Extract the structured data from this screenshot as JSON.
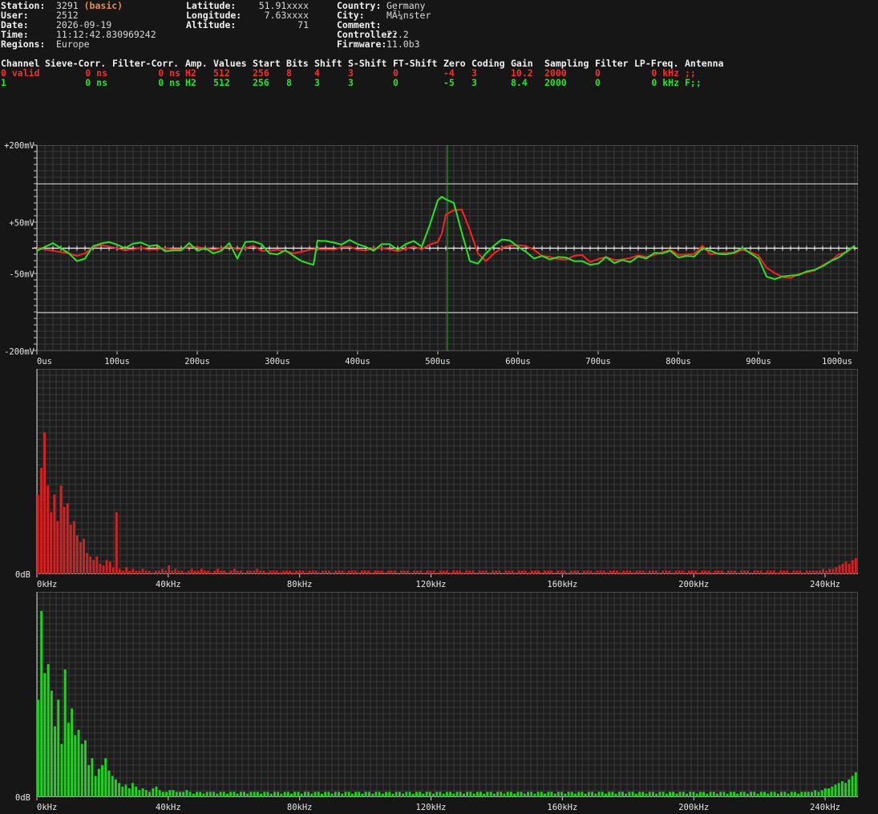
{
  "info_left": [
    {
      "label": "Station:",
      "value": "3291",
      "tag": "(basic)"
    },
    {
      "label": "User:",
      "value": "2512"
    },
    {
      "label": "Date:",
      "value": "2026-09-19"
    },
    {
      "label": "Time:",
      "value": "11:12:42.830969242"
    },
    {
      "label": "Regions:",
      "value": "Europe"
    }
  ],
  "info_mid": [
    {
      "label": "Latitude:",
      "value": "51.91xxxx"
    },
    {
      "label": "Longitude:",
      "value": "7.63xxxx"
    },
    {
      "label": "Altitude:",
      "value": "71"
    }
  ],
  "info_right": [
    {
      "label": "Country:",
      "value": "Germany"
    },
    {
      "label": "City:",
      "value": "MÃ¼nster"
    },
    {
      "label": "Comment:",
      "value": ""
    },
    {
      "label": "Controller:",
      "value": "22.2"
    },
    {
      "label": "Firmware:",
      "value": "11.0b3"
    }
  ],
  "channel_table": {
    "headers": [
      "Channel",
      "Sieve-Corr.",
      "Filter-Corr.",
      "Amp.",
      "Values",
      "Start",
      "Bits",
      "Shift",
      "S-Shift",
      "FT-Shift",
      "Zero",
      "Coding",
      "Gain",
      "Sampling",
      "Filter",
      "LP-Freq.",
      "Antenna"
    ],
    "rows": [
      {
        "color": "#ff2a2a",
        "cells": [
          "0 valid",
          "0 ns",
          "0 ns",
          "H2",
          "512",
          "256",
          "8",
          "4",
          "3",
          "0",
          "-4",
          "3",
          "10.2",
          "2000",
          "0",
          "0 kHz",
          ";;"
        ]
      },
      {
        "color": "#22e822",
        "cells": [
          "1",
          "0 ns",
          "0 ns",
          "H2",
          "512",
          "256",
          "8",
          "3",
          "3",
          "0",
          "-5",
          "3",
          "8.4",
          "2000",
          "0",
          "0 kHz",
          "F;;"
        ]
      }
    ]
  },
  "chart_data": [
    {
      "type": "line",
      "title": "",
      "xlabel": "",
      "ylabel": "",
      "xlim": [
        0,
        1024
      ],
      "ylim": [
        -200,
        200
      ],
      "x_tick_labels": [
        "0us",
        "100us",
        "200us",
        "300us",
        "400us",
        "500us",
        "600us",
        "700us",
        "800us",
        "900us",
        "1000us"
      ],
      "y_tick_labels": [
        {
          "label": "+200mV",
          "value": 200
        },
        {
          "label": "+50mV",
          "value": 50
        },
        {
          "label": "-50mV",
          "value": -50
        },
        {
          "label": "-200mV",
          "value": -200
        }
      ],
      "threshold_lines": [
        125,
        -125
      ],
      "trigger_marker_x": 512,
      "grid": true,
      "x": [
        0,
        20,
        40,
        50,
        60,
        70,
        80,
        90,
        100,
        110,
        120,
        130,
        140,
        150,
        160,
        170,
        180,
        190,
        200,
        210,
        220,
        230,
        240,
        250,
        260,
        270,
        280,
        290,
        300,
        310,
        320,
        330,
        340,
        345,
        350,
        355,
        360,
        370,
        380,
        390,
        400,
        410,
        420,
        430,
        440,
        450,
        460,
        470,
        480,
        490,
        500,
        505,
        510,
        520,
        530,
        540,
        550,
        560,
        570,
        580,
        590,
        600,
        610,
        620,
        630,
        640,
        650,
        660,
        670,
        680,
        690,
        700,
        710,
        720,
        730,
        740,
        750,
        760,
        770,
        780,
        790,
        800,
        810,
        820,
        830,
        840,
        850,
        860,
        870,
        880,
        890,
        900,
        910,
        920,
        930,
        940,
        950,
        960,
        970,
        980,
        990,
        1000,
        1010,
        1020
      ],
      "series": [
        {
          "color": "#ff2020",
          "values": [
            0,
            -5,
            -10,
            -15,
            -10,
            2,
            6,
            3,
            0,
            -4,
            -2,
            1,
            -3,
            -2,
            0,
            -2,
            -2,
            3,
            2,
            0,
            -3,
            0,
            3,
            -2,
            0,
            5,
            -5,
            -5,
            -3,
            -6,
            -10,
            -7,
            -3,
            -2,
            -1,
            -3,
            -2,
            -3,
            2,
            3,
            -3,
            -4,
            0,
            0,
            -2,
            -6,
            -1,
            3,
            -2,
            7,
            12,
            28,
            65,
            74,
            75,
            35,
            -10,
            -25,
            -10,
            1,
            5,
            6,
            4,
            -3,
            -15,
            -17,
            -21,
            -22,
            -15,
            -13,
            -27,
            -21,
            -17,
            -23,
            -22,
            -19,
            -14,
            -17,
            -13,
            -8,
            -3,
            -13,
            -12,
            -11,
            5,
            -12,
            -10,
            -9,
            -10,
            -3,
            -8,
            -14,
            -38,
            -48,
            -56,
            -58,
            -50,
            -47,
            -43,
            -33,
            -25,
            -12,
            -8,
            5
          ]
        },
        {
          "color": "#22e822",
          "values": [
            -5,
            10,
            -10,
            -25,
            -20,
            4,
            9,
            12,
            7,
            0,
            9,
            11,
            4,
            6,
            -6,
            -4,
            -4,
            10,
            -5,
            0,
            -10,
            -5,
            10,
            -20,
            12,
            13,
            8,
            -10,
            -12,
            -4,
            -15,
            -25,
            -30,
            -32,
            15,
            14,
            14,
            11,
            7,
            16,
            8,
            3,
            -5,
            8,
            8,
            -3,
            8,
            14,
            3,
            45,
            93,
            100,
            95,
            88,
            30,
            -25,
            -30,
            -10,
            5,
            17,
            15,
            3,
            -7,
            -20,
            -15,
            -22,
            -17,
            -18,
            -25,
            -25,
            -32,
            -30,
            -17,
            -29,
            -23,
            -27,
            -16,
            -20,
            -9,
            -10,
            -5,
            -18,
            -15,
            -16,
            0,
            -5,
            -11,
            -12,
            -8,
            1,
            -10,
            -20,
            -55,
            -60,
            -55,
            -53,
            -52,
            -45,
            -42,
            -35,
            -25,
            -18,
            -6,
            5
          ]
        }
      ]
    },
    {
      "type": "bar",
      "title": "",
      "xlabel": "",
      "ylabel": "",
      "xlim": [
        0,
        250
      ],
      "x_tick_labels": [
        "0kHz",
        "40kHz",
        "80kHz",
        "120kHz",
        "160kHz",
        "200kHz",
        "240kHz"
      ],
      "y_tick_labels": [
        {
          "label": "0dB",
          "value": 0
        }
      ],
      "grid": true,
      "series": [
        {
          "color": "#d42020",
          "values": [
            45,
            60,
            80,
            50,
            35,
            45,
            30,
            50,
            38,
            40,
            28,
            30,
            22,
            18,
            20,
            12,
            10,
            8,
            10,
            6,
            5,
            8,
            7,
            4,
            35,
            3,
            2,
            4,
            2,
            3,
            2,
            2,
            3,
            2,
            2,
            1,
            2,
            2,
            3,
            2,
            5,
            2,
            3,
            2,
            2,
            1,
            2,
            3,
            2,
            2,
            3,
            2,
            2,
            1,
            2,
            3,
            2,
            2,
            1,
            2,
            3,
            2,
            2,
            1,
            2,
            2,
            2,
            3,
            2,
            2,
            1,
            2,
            2,
            2,
            1,
            2,
            2,
            2,
            1,
            2,
            2,
            2,
            1,
            2,
            2,
            2,
            1,
            2,
            2,
            2,
            1,
            2,
            2,
            2,
            1,
            2,
            2,
            2,
            1,
            2,
            2,
            2,
            1,
            2,
            2,
            2,
            1,
            2,
            2,
            2,
            1,
            2,
            2,
            2,
            1,
            2,
            2,
            2,
            1,
            2,
            2,
            2,
            1,
            2,
            2,
            2,
            1,
            2,
            2,
            2,
            1,
            2,
            2,
            2,
            1,
            2,
            2,
            2,
            1,
            2,
            2,
            2,
            1,
            2,
            2,
            2,
            1,
            2,
            2,
            2,
            1,
            2,
            2,
            2,
            1,
            2,
            2,
            2,
            1,
            2,
            2,
            2,
            1,
            2,
            2,
            2,
            1,
            2,
            2,
            2,
            1,
            2,
            2,
            2,
            1,
            2,
            2,
            2,
            1,
            2,
            2,
            2,
            1,
            2,
            2,
            2,
            1,
            2,
            2,
            2,
            1,
            2,
            2,
            2,
            1,
            2,
            2,
            2,
            1,
            2,
            2,
            2,
            1,
            2,
            2,
            2,
            1,
            2,
            2,
            2,
            1,
            2,
            2,
            2,
            1,
            2,
            2,
            2,
            1,
            2,
            2,
            2,
            1,
            2,
            2,
            2,
            1,
            2,
            2,
            2,
            1,
            2,
            2,
            2,
            1,
            2,
            2,
            2,
            2,
            2,
            3,
            2,
            3,
            3,
            4,
            5,
            6,
            7,
            6,
            8,
            9
          ]
        }
      ]
    },
    {
      "type": "bar",
      "title": "",
      "xlabel": "",
      "ylabel": "",
      "xlim": [
        0,
        250
      ],
      "x_tick_labels": [
        "0kHz",
        "40kHz",
        "80kHz",
        "120kHz",
        "160kHz",
        "200kHz",
        "240kHz"
      ],
      "y_tick_labels": [
        {
          "label": "0dB",
          "value": 0
        }
      ],
      "grid": true,
      "series": [
        {
          "color": "#22d022",
          "values": [
            55,
            105,
            70,
            75,
            60,
            40,
            55,
            30,
            72,
            42,
            50,
            35,
            38,
            30,
            32,
            18,
            22,
            12,
            16,
            18,
            22,
            15,
            12,
            10,
            8,
            6,
            7,
            5,
            8,
            6,
            4,
            5,
            4,
            3,
            5,
            6,
            4,
            3,
            3,
            4,
            4,
            3,
            3,
            3,
            4,
            3,
            2,
            3,
            3,
            2,
            3,
            3,
            3,
            2,
            3,
            3,
            2,
            3,
            3,
            2,
            3,
            3,
            2,
            3,
            3,
            3,
            2,
            3,
            3,
            2,
            3,
            3,
            2,
            3,
            3,
            2,
            3,
            3,
            2,
            3,
            3,
            2,
            3,
            3,
            2,
            3,
            3,
            2,
            3,
            3,
            2,
            3,
            3,
            2,
            3,
            3,
            2,
            3,
            3,
            2,
            3,
            3,
            2,
            3,
            3,
            2,
            3,
            3,
            2,
            3,
            3,
            2,
            3,
            3,
            2,
            3,
            3,
            2,
            3,
            3,
            2,
            3,
            3,
            2,
            3,
            3,
            2,
            3,
            3,
            2,
            3,
            3,
            2,
            3,
            3,
            2,
            3,
            3,
            2,
            3,
            3,
            2,
            3,
            3,
            2,
            3,
            3,
            2,
            3,
            3,
            2,
            3,
            3,
            2,
            3,
            3,
            2,
            3,
            3,
            2,
            3,
            3,
            2,
            3,
            3,
            2,
            3,
            3,
            2,
            3,
            3,
            2,
            3,
            3,
            2,
            3,
            3,
            2,
            3,
            3,
            2,
            3,
            3,
            2,
            3,
            3,
            2,
            3,
            3,
            2,
            3,
            3,
            2,
            3,
            3,
            2,
            3,
            3,
            2,
            3,
            3,
            2,
            3,
            3,
            2,
            3,
            3,
            2,
            3,
            3,
            2,
            3,
            3,
            2,
            3,
            3,
            2,
            3,
            3,
            2,
            3,
            3,
            2,
            3,
            3,
            2,
            3,
            3,
            3,
            3,
            4,
            3,
            4,
            5,
            5,
            6,
            7,
            8,
            9,
            8,
            10,
            12,
            14
          ]
        }
      ]
    }
  ]
}
